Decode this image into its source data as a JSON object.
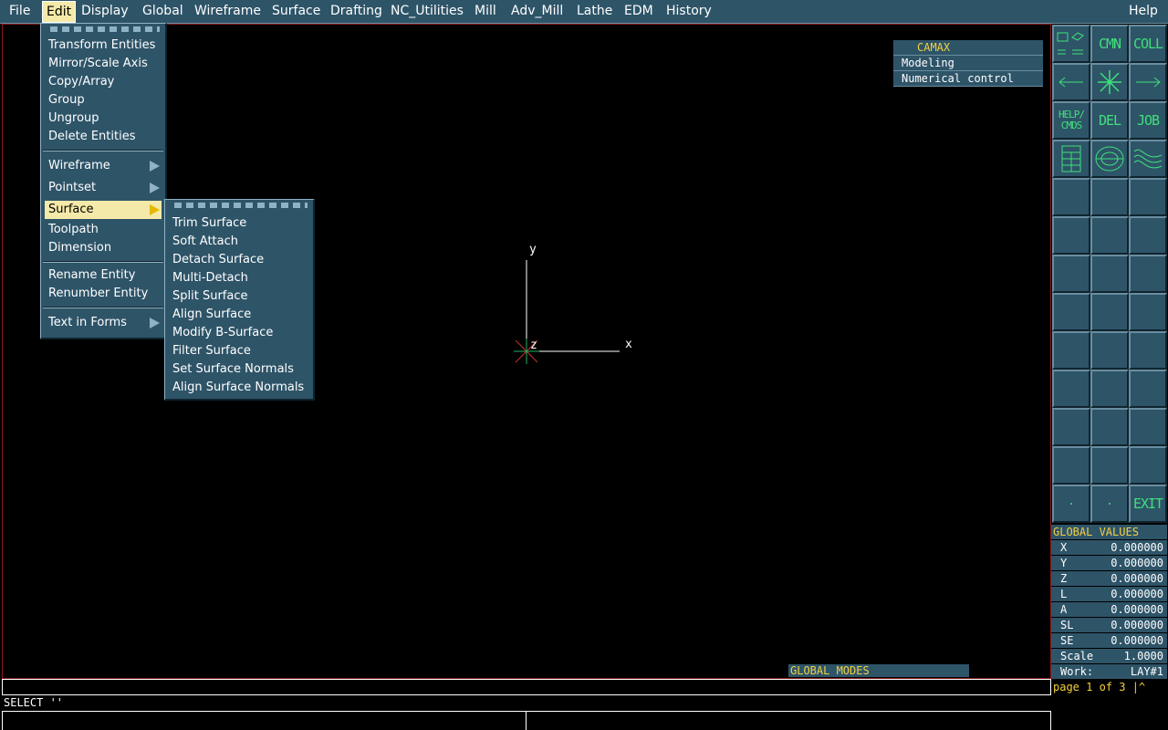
{
  "menubar": [
    "File",
    "Edit",
    "Display",
    "Global",
    "Wireframe",
    "Surface",
    "Drafting",
    "NC_Utilities",
    "Mill",
    "Adv_Mill",
    "Lathe",
    "EDM",
    "History",
    "Help"
  ],
  "edit_menu": {
    "group1": [
      "Transform Entities",
      "Mirror/Scale Axis",
      "Copy/Array",
      "Group",
      "Ungroup",
      "Delete Entities"
    ],
    "group2": [
      "Wireframe",
      "Pointset",
      "Surface",
      "Toolpath",
      "Dimension"
    ],
    "group3": [
      "Rename Entity",
      "Renumber Entity"
    ],
    "group4": [
      "Text in Forms"
    ]
  },
  "surface_submenu": [
    "Trim Surface",
    "Soft Attach",
    "Detach Surface",
    "Multi-Detach",
    "Split Surface",
    "Align Surface",
    "Modify B-Surface",
    "Filter Surface",
    "Set Surface Normals",
    "Align Surface Normals"
  ],
  "axes": {
    "x": "x",
    "y": "y",
    "z": "z"
  },
  "camax": {
    "title": "CAMAX",
    "items": [
      "Modeling",
      "Numerical control"
    ]
  },
  "tools": {
    "cmn": "CMN",
    "coll": "COLL",
    "help_line1": "HELP/",
    "help_line2": "CMDS",
    "del": "DEL",
    "job": "JOB",
    "exit": "EXIT"
  },
  "global_values": {
    "header": "GLOBAL VALUES",
    "rows": [
      [
        "X",
        "0.000000"
      ],
      [
        "Y",
        "0.000000"
      ],
      [
        "Z",
        "0.000000"
      ],
      [
        "L",
        "0.000000"
      ],
      [
        "A",
        "0.000000"
      ],
      [
        "SL",
        "0.000000"
      ],
      [
        "SE",
        "0.000000"
      ],
      [
        "Scale",
        "1.0000"
      ],
      [
        "Work:",
        "LAY#1"
      ]
    ],
    "page": "page 1 of 3 |^"
  },
  "global_modes": "GLOBAL MODES",
  "command": {
    "select": "SELECT ''"
  },
  "colors": {
    "panel": "#2e5468",
    "highlight": "#f4e9a8",
    "tool_green": "#3fe07a",
    "yellow": "#f4d03f"
  }
}
